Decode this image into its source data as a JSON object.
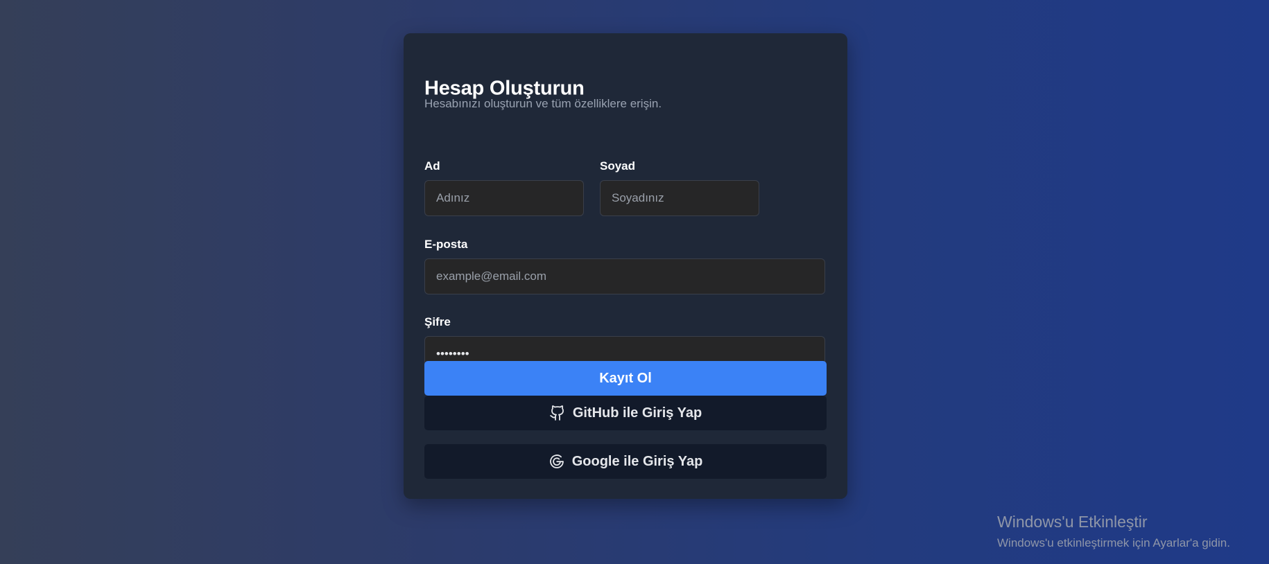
{
  "form": {
    "title": "Hesap Oluşturun",
    "subtitle": "Hesabınızı oluşturun ve tüm özelliklere erişin.",
    "first_name": {
      "label": "Ad",
      "placeholder": "Adınız",
      "value": ""
    },
    "last_name": {
      "label": "Soyad",
      "placeholder": "Soyadınız",
      "value": ""
    },
    "email": {
      "label": "E-posta",
      "placeholder": "example@email.com",
      "value": ""
    },
    "password": {
      "label": "Şifre",
      "value": "12345678"
    },
    "submit_label": "Kayıt Ol",
    "github_label": "GitHub ile Giriş Yap",
    "google_label": "Google ile Giriş Yap",
    "icons": {
      "github": "github-icon",
      "google": "google-icon"
    }
  },
  "watermark": {
    "title": "Windows'u Etkinleştir",
    "subtitle": "Windows'u etkinleştirmek için Ayarlar'a gidin."
  },
  "colors": {
    "primary_button": "#3b82f6",
    "card_background": "#1f2838",
    "input_background": "#262627",
    "social_button": "#121a2a"
  }
}
